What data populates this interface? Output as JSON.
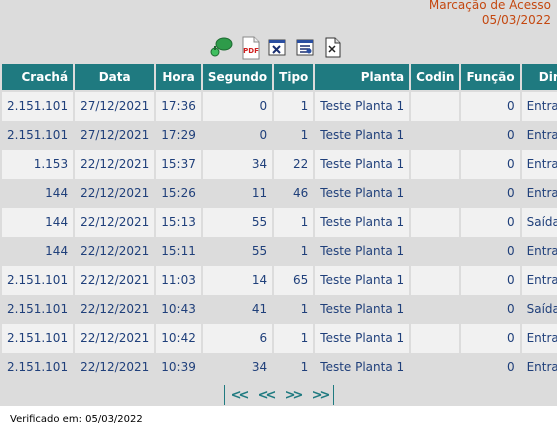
{
  "header": {
    "title": "Marcação de Acesso",
    "date": "05/03/2022"
  },
  "toolbar": {
    "icons": [
      "map-marker-icon",
      "pdf-icon",
      "excel-icon",
      "word-icon",
      "document-icon"
    ],
    "pdf_label": "PDF"
  },
  "table": {
    "columns": [
      "Crachá",
      "Data",
      "Hora",
      "Segundo",
      "Tipo",
      "Planta",
      "Codin",
      "Função",
      "Dir."
    ],
    "rows": [
      {
        "cracha": "2.151.101",
        "data": "27/12/2021",
        "hora": "17:36",
        "segundo": "0",
        "tipo": "1",
        "planta": "Teste Planta 1",
        "codin": "",
        "funcao": "0",
        "dir": "Entrada"
      },
      {
        "cracha": "2.151.101",
        "data": "27/12/2021",
        "hora": "17:29",
        "segundo": "0",
        "tipo": "1",
        "planta": "Teste Planta 1",
        "codin": "",
        "funcao": "0",
        "dir": "Entrada"
      },
      {
        "cracha": "1.153",
        "data": "22/12/2021",
        "hora": "15:37",
        "segundo": "34",
        "tipo": "22",
        "planta": "Teste Planta 1",
        "codin": "",
        "funcao": "0",
        "dir": "Entrada"
      },
      {
        "cracha": "144",
        "data": "22/12/2021",
        "hora": "15:26",
        "segundo": "11",
        "tipo": "46",
        "planta": "Teste Planta 1",
        "codin": "",
        "funcao": "0",
        "dir": "Entrada"
      },
      {
        "cracha": "144",
        "data": "22/12/2021",
        "hora": "15:13",
        "segundo": "55",
        "tipo": "1",
        "planta": "Teste Planta 1",
        "codin": "",
        "funcao": "0",
        "dir": "Saída"
      },
      {
        "cracha": "144",
        "data": "22/12/2021",
        "hora": "15:11",
        "segundo": "55",
        "tipo": "1",
        "planta": "Teste Planta 1",
        "codin": "",
        "funcao": "0",
        "dir": "Entrada"
      },
      {
        "cracha": "2.151.101",
        "data": "22/12/2021",
        "hora": "11:03",
        "segundo": "14",
        "tipo": "65",
        "planta": "Teste Planta 1",
        "codin": "",
        "funcao": "0",
        "dir": "Entrada"
      },
      {
        "cracha": "2.151.101",
        "data": "22/12/2021",
        "hora": "10:43",
        "segundo": "41",
        "tipo": "1",
        "planta": "Teste Planta 1",
        "codin": "",
        "funcao": "0",
        "dir": "Saída"
      },
      {
        "cracha": "2.151.101",
        "data": "22/12/2021",
        "hora": "10:42",
        "segundo": "6",
        "tipo": "1",
        "planta": "Teste Planta 1",
        "codin": "",
        "funcao": "0",
        "dir": "Entrada"
      },
      {
        "cracha": "2.151.101",
        "data": "22/12/2021",
        "hora": "10:39",
        "segundo": "34",
        "tipo": "1",
        "planta": "Teste Planta 1",
        "codin": "",
        "funcao": "0",
        "dir": "Entrada"
      }
    ]
  },
  "pager": {
    "first": "<<",
    "prev": "<<",
    "next": ">>",
    "last": ">>"
  },
  "footer": {
    "verified": "Verificado em: 05/03/2022"
  },
  "colors": {
    "header_bg": "#1f7a80",
    "title_orange": "#c4470f",
    "cell_text": "#1f3f7a"
  }
}
